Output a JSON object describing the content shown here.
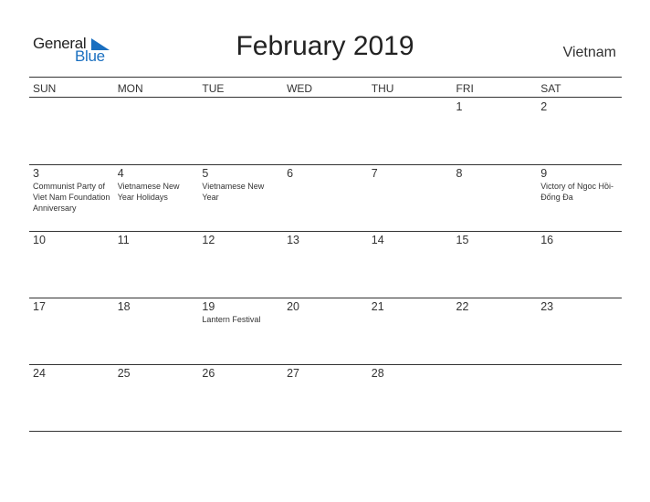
{
  "logo": {
    "general": "General",
    "blue": "Blue",
    "brand_color": "#1a6fc0"
  },
  "title": "February 2019",
  "country": "Vietnam",
  "days_of_week": [
    "SUN",
    "MON",
    "TUE",
    "WED",
    "THU",
    "FRI",
    "SAT"
  ],
  "weeks": [
    [
      {
        "day": ""
      },
      {
        "day": ""
      },
      {
        "day": ""
      },
      {
        "day": ""
      },
      {
        "day": ""
      },
      {
        "day": "1"
      },
      {
        "day": "2"
      }
    ],
    [
      {
        "day": "3",
        "holiday": "Communist Party of Viet Nam Foundation Anniversary"
      },
      {
        "day": "4",
        "holiday": "Vietnamese New Year Holidays"
      },
      {
        "day": "5",
        "holiday": "Vietnamese New Year"
      },
      {
        "day": "6"
      },
      {
        "day": "7"
      },
      {
        "day": "8"
      },
      {
        "day": "9",
        "holiday": "Victory of Ngoc Hồi-Đống Đa"
      }
    ],
    [
      {
        "day": "10"
      },
      {
        "day": "11"
      },
      {
        "day": "12"
      },
      {
        "day": "13"
      },
      {
        "day": "14"
      },
      {
        "day": "15"
      },
      {
        "day": "16"
      }
    ],
    [
      {
        "day": "17"
      },
      {
        "day": "18"
      },
      {
        "day": "19",
        "holiday": "Lantern Festival"
      },
      {
        "day": "20"
      },
      {
        "day": "21"
      },
      {
        "day": "22"
      },
      {
        "day": "23"
      }
    ],
    [
      {
        "day": "24"
      },
      {
        "day": "25"
      },
      {
        "day": "26"
      },
      {
        "day": "27"
      },
      {
        "day": "28"
      },
      {
        "day": ""
      },
      {
        "day": ""
      }
    ]
  ]
}
